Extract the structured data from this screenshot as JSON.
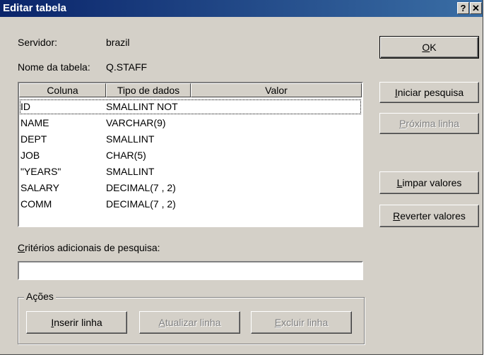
{
  "window": {
    "title": "Editar tabela",
    "help_button": "?",
    "close_button": "✕"
  },
  "info": {
    "server_label": "Servidor:",
    "server_value": "brazil",
    "table_label": "Nome da tabela:",
    "table_value": "Q.STAFF"
  },
  "grid": {
    "columns": [
      "Coluna",
      "Tipo de dados",
      "Valor"
    ],
    "rows": [
      {
        "col": "ID",
        "type": "SMALLINT NOT",
        "value": ""
      },
      {
        "col": "NAME",
        "type": "VARCHAR(9)",
        "value": ""
      },
      {
        "col": "DEPT",
        "type": "SMALLINT",
        "value": ""
      },
      {
        "col": "JOB",
        "type": "CHAR(5)",
        "value": ""
      },
      {
        "col": "\"YEARS\"",
        "type": "SMALLINT",
        "value": ""
      },
      {
        "col": "SALARY",
        "type": "DECIMAL(7 , 2)",
        "value": ""
      },
      {
        "col": "COMM",
        "type": "DECIMAL(7 , 2)",
        "value": ""
      }
    ]
  },
  "criteria": {
    "label_first": "C",
    "label_rest": "ritérios adicionais de pesquisa:",
    "value": ""
  },
  "actions": {
    "legend": "Ações",
    "insert": "Inserir linha",
    "update": "Atualizar linha",
    "delete": "Excluir linha"
  },
  "side_buttons": {
    "ok": "OK",
    "start_search": "Iniciar pesquisa",
    "next_row": "Próxima linha",
    "clear_values": "Limpar valores",
    "revert_values": "Reverter valores"
  }
}
